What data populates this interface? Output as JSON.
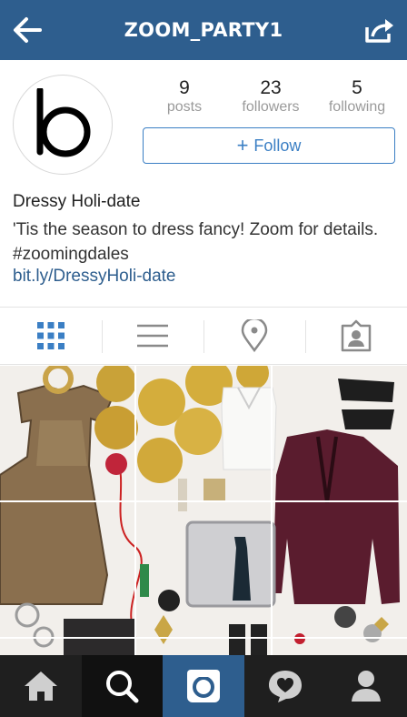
{
  "header": {
    "title": "ZOOM_PARTY1"
  },
  "profile": {
    "avatar_letter": "b",
    "stats": [
      {
        "value": "9",
        "label": "posts"
      },
      {
        "value": "23",
        "label": "followers"
      },
      {
        "value": "5",
        "label": "following"
      }
    ],
    "follow_button": {
      "icon": "+",
      "label": "Follow"
    },
    "name": "Dressy Holi-date",
    "bio": "'Tis the season to dress fancy! Zoom for details. #zoomingdales",
    "link": "bit.ly/DressyHoli-date"
  },
  "view_tabs": [
    {
      "icon": "grid-icon",
      "active": true
    },
    {
      "icon": "list-icon",
      "active": false
    },
    {
      "icon": "location-pin-icon",
      "active": false
    },
    {
      "icon": "tagged-user-icon",
      "active": false
    }
  ],
  "bottom_nav": [
    {
      "icon": "home-icon"
    },
    {
      "icon": "search-icon"
    },
    {
      "icon": "camera-icon"
    },
    {
      "icon": "activity-heart-icon"
    },
    {
      "icon": "profile-icon"
    }
  ],
  "colors": {
    "header_bg": "#2e5e8e",
    "accent": "#3b7fc4",
    "nav_bg": "#1f1f1f"
  }
}
